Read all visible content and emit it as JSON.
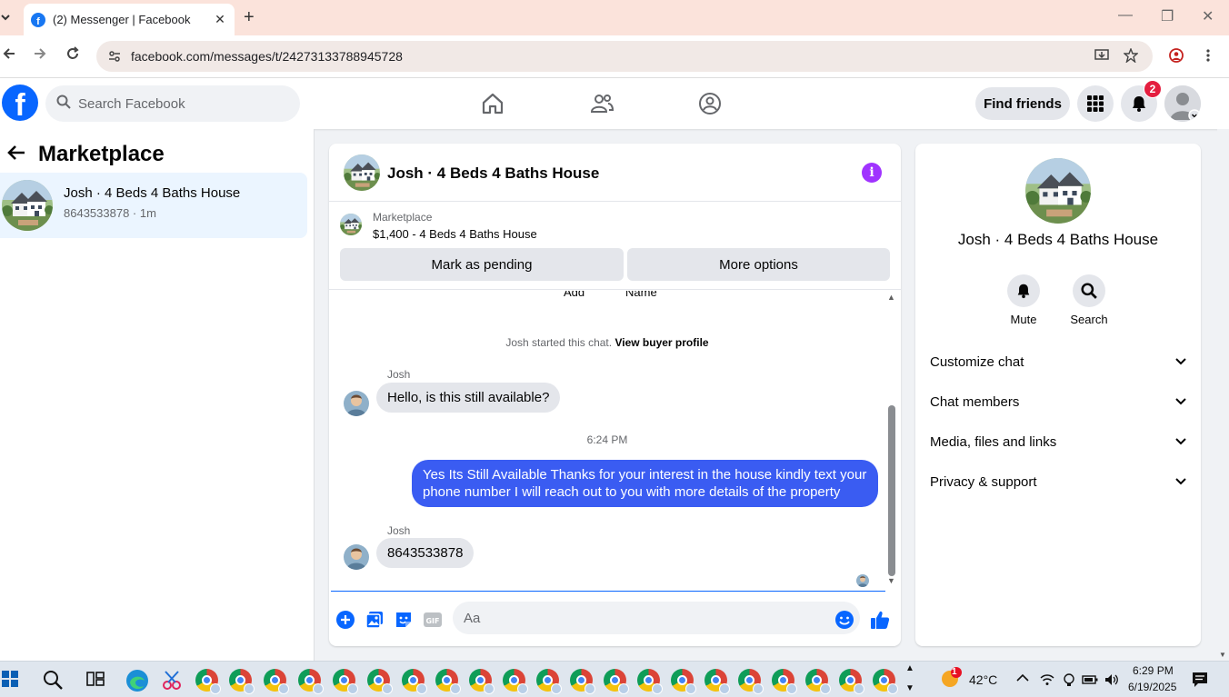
{
  "browser": {
    "tab_title": "(2) Messenger | Facebook",
    "url": "facebook.com/messages/t/24273133788945728"
  },
  "header": {
    "search_placeholder": "Search Facebook",
    "find_friends": "Find friends",
    "notification_count": "2"
  },
  "sidebar": {
    "title": "Marketplace",
    "conversation": {
      "name": "Josh · 4 Beds 4 Baths House",
      "subtitle": "8643533878 · 1m"
    }
  },
  "chat": {
    "title": "Josh · 4 Beds 4 Baths House",
    "marketplace_label": "Marketplace",
    "listing": "$1,400 - 4 Beds 4 Baths House",
    "mark_pending": "Mark as pending",
    "more_options": "More options",
    "cutoff_left": "Add",
    "cutoff_right": "Name",
    "system_text": "Josh started this chat.",
    "system_link": "View buyer profile",
    "messages": [
      {
        "sender": "Josh",
        "text": "Hello, is this still available?"
      },
      {
        "time": "6:24 PM"
      },
      {
        "text": "Yes Its Still Available Thanks for your interest in the house kindly text your phone number I will reach out to you with more details of the property"
      },
      {
        "sender": "Josh",
        "text": "8643533878"
      }
    ],
    "composer_placeholder": "Aa"
  },
  "details": {
    "name": "Josh · 4 Beds 4 Baths House",
    "mute": "Mute",
    "search": "Search",
    "sections": [
      "Customize chat",
      "Chat members",
      "Media, files and links",
      "Privacy & support"
    ]
  },
  "taskbar": {
    "temperature": "42°C",
    "time": "6:29 PM",
    "date": "6/19/2025",
    "weather_badge": "1"
  },
  "colors": {
    "fb_blue": "#0866ff",
    "outgoing_bubble": "#3a5cf2",
    "selected_conv": "#ebf5ff",
    "info_purple": "#a033ff"
  }
}
